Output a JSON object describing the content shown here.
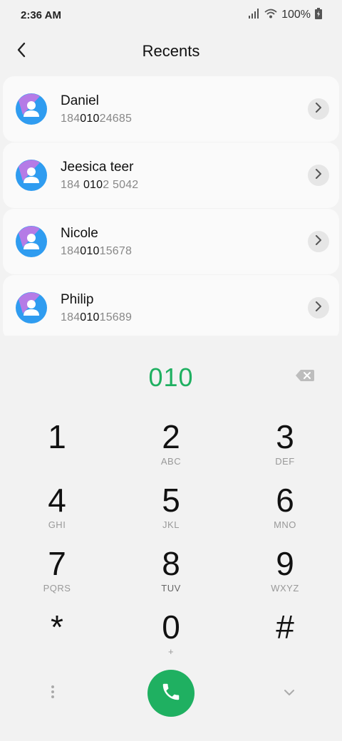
{
  "status_bar": {
    "time": "2:36 AM",
    "battery": "100%"
  },
  "header": {
    "title": "Recents"
  },
  "contacts": [
    {
      "name": "Daniel",
      "number_pre": "184",
      "number_match": "010",
      "number_post": "24685"
    },
    {
      "name": "Jeesica teer",
      "number_pre": "184 ",
      "number_match": "010",
      "number_post": "2 5042"
    },
    {
      "name": "Nicole",
      "number_pre": "184",
      "number_match": "010",
      "number_post": "15678"
    },
    {
      "name": "Philip",
      "number_pre": "184",
      "number_match": "010",
      "number_post": "15689"
    }
  ],
  "dialer": {
    "input": "010",
    "keys": [
      {
        "digit": "1",
        "letters": ""
      },
      {
        "digit": "2",
        "letters": "ABC"
      },
      {
        "digit": "3",
        "letters": "DEF"
      },
      {
        "digit": "4",
        "letters": "GHI"
      },
      {
        "digit": "5",
        "letters": "JKL"
      },
      {
        "digit": "6",
        "letters": "MNO"
      },
      {
        "digit": "7",
        "letters": "PQRS"
      },
      {
        "digit": "8",
        "letters": "TUV"
      },
      {
        "digit": "9",
        "letters": "WXYZ"
      },
      {
        "digit": "*",
        "letters": ""
      },
      {
        "digit": "0",
        "letters": "+"
      },
      {
        "digit": "#",
        "letters": ""
      }
    ]
  },
  "icons": {
    "back": "back-arrow-icon",
    "chevron": "chevron-right-icon",
    "backspace": "backspace-icon",
    "call": "phone-icon",
    "more": "more-vertical-icon",
    "collapse": "chevron-down-icon"
  },
  "colors": {
    "accent": "#1fb061",
    "avatar_blue": "#2f9cf0",
    "avatar_purple": "#b57be6"
  }
}
